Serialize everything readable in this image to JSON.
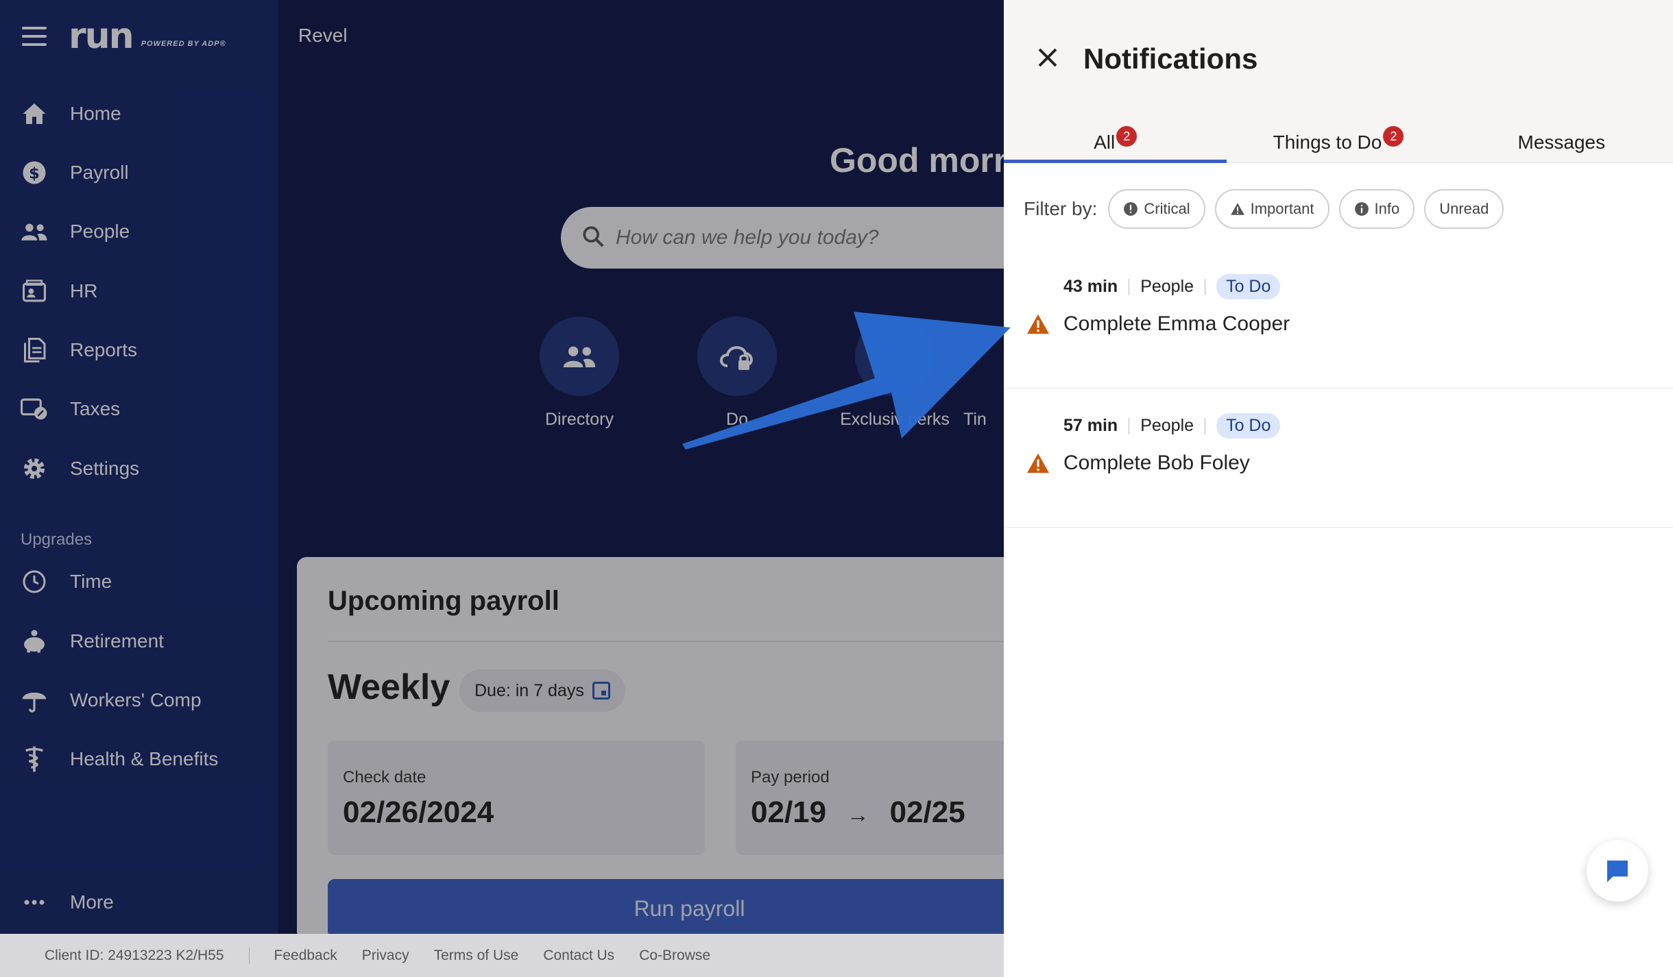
{
  "sidebar": {
    "logo": "run",
    "powered_by": "POWERED BY ADP®",
    "items": [
      {
        "label": "Home"
      },
      {
        "label": "Payroll"
      },
      {
        "label": "People"
      },
      {
        "label": "HR"
      },
      {
        "label": "Reports"
      },
      {
        "label": "Taxes"
      },
      {
        "label": "Settings"
      }
    ],
    "upgrades_heading": "Upgrades",
    "upgrades": [
      {
        "label": "Time"
      },
      {
        "label": "Retirement"
      },
      {
        "label": "Workers' Comp"
      },
      {
        "label": "Health & Benefits"
      }
    ],
    "more_label": "More"
  },
  "main": {
    "company": "Revel",
    "greeting": "Good morn",
    "search_placeholder": "How can we help you today?",
    "quick_links": [
      {
        "label": "Directory",
        "icon": "people-icon"
      },
      {
        "label": "Do",
        "icon": "cloud-lock-icon"
      },
      {
        "label": "Exclusiv  perks",
        "icon": "perks-icon"
      },
      {
        "label": "Tin",
        "icon": "time-icon"
      }
    ],
    "payroll_card": {
      "title": "Upcoming payroll",
      "schedule": "Weekly",
      "due": "Due: in 7 days",
      "check_date_label": "Check date",
      "check_date": "02/26/2024",
      "pay_period_label": "Pay period",
      "pay_period_start": "02/19",
      "pay_period_arrow": "→",
      "pay_period_end": "02/25",
      "run_label": "Run payroll"
    }
  },
  "footer": {
    "client_id": "Client ID: 24913223 K2/H55",
    "links": [
      "Feedback",
      "Privacy",
      "Terms of Use",
      "Contact Us",
      "Co-Browse"
    ]
  },
  "notifications": {
    "title": "Notifications",
    "tabs": [
      {
        "label": "All",
        "badge": "2",
        "active": true
      },
      {
        "label": "Things to Do",
        "badge": "2",
        "active": false
      },
      {
        "label": "Messages",
        "badge": "",
        "active": false
      }
    ],
    "filter_label": "Filter by:",
    "filters": [
      {
        "label": "Critical",
        "icon": "critical-icon"
      },
      {
        "label": "Important",
        "icon": "warning-icon"
      },
      {
        "label": "Info",
        "icon": "info-icon"
      },
      {
        "label": "Unread",
        "icon": ""
      }
    ],
    "items": [
      {
        "time": "43 min",
        "category": "People",
        "tag": "To Do",
        "message": "Complete Emma Cooper"
      },
      {
        "time": "57 min",
        "category": "People",
        "tag": "To Do",
        "message": "Complete Bob Foley"
      }
    ]
  },
  "colors": {
    "sidebar_bg": "#132464",
    "main_bg": "#0e1646",
    "accent": "#3b5cc4",
    "badge": "#c62828",
    "warning": "#c85a0a",
    "arrow": "#2a6ad0"
  }
}
